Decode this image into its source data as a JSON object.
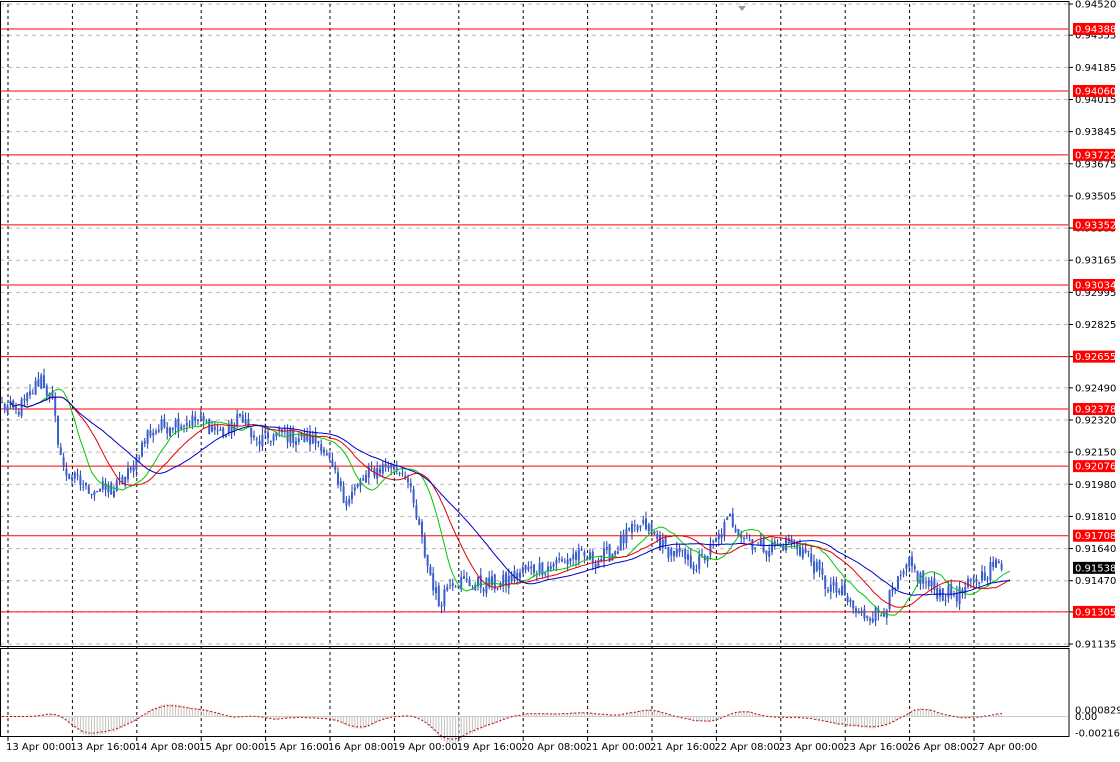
{
  "colors": {
    "background": "#ffffff",
    "frame": "#000000",
    "grid": "#000000",
    "candle_body": "#3a5fcd",
    "wick": "#1f3fa8",
    "ma_fast": "#00c800",
    "ma_mid": "#e00000",
    "ma_slow": "#0000c8",
    "level_line": "#ff0000",
    "level_label_bg": "#ff0000",
    "level_label_text": "#ffffff",
    "current_label_bg": "#000000",
    "current_label_text": "#ffffff",
    "osc_hist": "#c0c0c0",
    "osc_signal": "#cc0000"
  },
  "chart_data": {
    "type": "candlestick",
    "price_axis": {
      "min": 0.9113,
      "max": 0.9452,
      "ticks": [
        "0.94520",
        "0.94355",
        "0.94185",
        "0.94015",
        "0.93845",
        "0.93675",
        "0.93505",
        "0.93335",
        "0.93165",
        "0.92995",
        "0.92825",
        "0.92655",
        "0.92490",
        "0.92320",
        "0.92150",
        "0.91980",
        "0.91810",
        "0.91640",
        "0.91470",
        "0.91305",
        "0.91135"
      ]
    },
    "time_axis": {
      "labels": [
        "13 Apr 00:00",
        "13 Apr 16:00",
        "14 Apr 08:00",
        "15 Apr 00:00",
        "15 Apr 16:00",
        "16 Apr 08:00",
        "19 Apr 00:00",
        "19 Apr 16:00",
        "20 Apr 08:00",
        "21 Apr 00:00",
        "21 Apr 16:00",
        "22 Apr 08:00",
        "23 Apr 00:00",
        "23 Apr 16:00",
        "26 Apr 08:00",
        "27 Apr 00:00"
      ]
    },
    "levels": [
      "0.94388",
      "0.94060",
      "0.93722",
      "0.93352",
      "0.93034",
      "0.92655",
      "0.92378",
      "0.92076",
      "0.91708",
      "0.91305"
    ],
    "current_price": "0.91538",
    "anchors": [
      [
        0,
        0.924
      ],
      [
        5,
        0.9236
      ],
      [
        10,
        0.9245
      ],
      [
        14,
        0.9255
      ],
      [
        18,
        0.924
      ],
      [
        22,
        0.9205
      ],
      [
        30,
        0.9196
      ],
      [
        40,
        0.9195
      ],
      [
        46,
        0.9205
      ],
      [
        52,
        0.9225
      ],
      [
        60,
        0.923
      ],
      [
        70,
        0.9232
      ],
      [
        80,
        0.9224
      ],
      [
        86,
        0.9235
      ],
      [
        90,
        0.922
      ],
      [
        100,
        0.9225
      ],
      [
        108,
        0.9222
      ],
      [
        114,
        0.922
      ],
      [
        118,
        0.9205
      ],
      [
        122,
        0.919
      ],
      [
        126,
        0.9195
      ],
      [
        132,
        0.9205
      ],
      [
        138,
        0.9208
      ],
      [
        144,
        0.9205
      ],
      [
        148,
        0.918
      ],
      [
        152,
        0.9155
      ],
      [
        156,
        0.9135
      ],
      [
        160,
        0.9148
      ],
      [
        168,
        0.9145
      ],
      [
        178,
        0.9145
      ],
      [
        186,
        0.9152
      ],
      [
        196,
        0.9155
      ],
      [
        204,
        0.916
      ],
      [
        212,
        0.9158
      ],
      [
        218,
        0.9162
      ],
      [
        224,
        0.9172
      ],
      [
        230,
        0.9176
      ],
      [
        236,
        0.9165
      ],
      [
        242,
        0.916
      ],
      [
        248,
        0.9155
      ],
      [
        254,
        0.9165
      ],
      [
        260,
        0.918
      ],
      [
        264,
        0.9172
      ],
      [
        270,
        0.9165
      ],
      [
        276,
        0.9165
      ],
      [
        282,
        0.9168
      ],
      [
        288,
        0.916
      ],
      [
        294,
        0.9145
      ],
      [
        300,
        0.914
      ],
      [
        306,
        0.9128
      ],
      [
        310,
        0.913
      ],
      [
        314,
        0.913
      ],
      [
        318,
        0.914
      ],
      [
        324,
        0.9155
      ],
      [
        330,
        0.9145
      ],
      [
        336,
        0.914
      ],
      [
        342,
        0.914
      ],
      [
        346,
        0.9145
      ],
      [
        350,
        0.915
      ],
      [
        354,
        0.9155
      ],
      [
        357,
        0.9155
      ]
    ],
    "oscillator": {
      "min": -0.00216,
      "max": 0.00829,
      "ticks": [
        "0.000829",
        "0.00",
        "-0.00216"
      ]
    }
  }
}
